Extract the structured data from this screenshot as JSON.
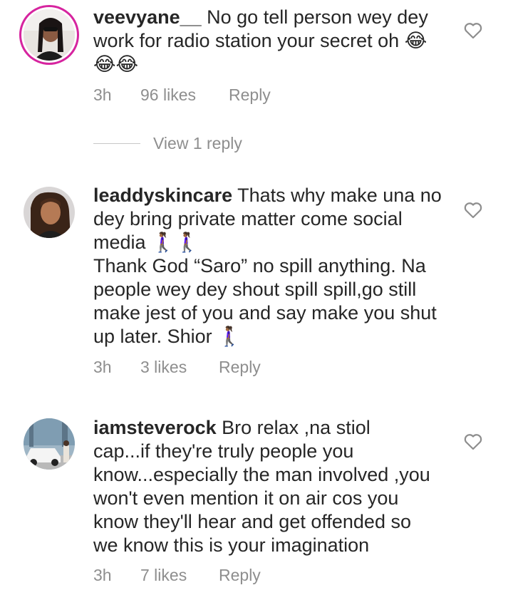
{
  "comments": [
    {
      "username": "veevyane__",
      "text": " No go tell person wey dey\nwork for radio station your secret oh 😂\n😂😂",
      "time": "3h",
      "likes": "96 likes",
      "reply": "Reply",
      "view_replies": "View 1 reply"
    },
    {
      "username": "leaddyskincare",
      "text": " Thats why make una no\ndey bring private matter come social\nmedia 🚶🏾‍♀️🚶🏾‍♀️\nThank God “Saro” no spill anything. Na\npeople wey dey shout spill spill,go still\nmake jest of you and say make you shut\nup later. Shior 🚶🏾‍♀️",
      "time": "3h",
      "likes": "3 likes",
      "reply": "Reply"
    },
    {
      "username": "iamsteverock",
      "text": " Bro relax ,na stiol\ncap...if they're truly people you\nknow...especially the man involved ,you\nwon't even mention it on air cos you\nknow they'll hear and get offended so\nwe know this is your imagination",
      "time": "3h",
      "likes": "7 likes",
      "reply": "Reply"
    }
  ],
  "icons": {
    "like": "heart-outline-icon",
    "avatar_ring_color": "#d6249f"
  }
}
